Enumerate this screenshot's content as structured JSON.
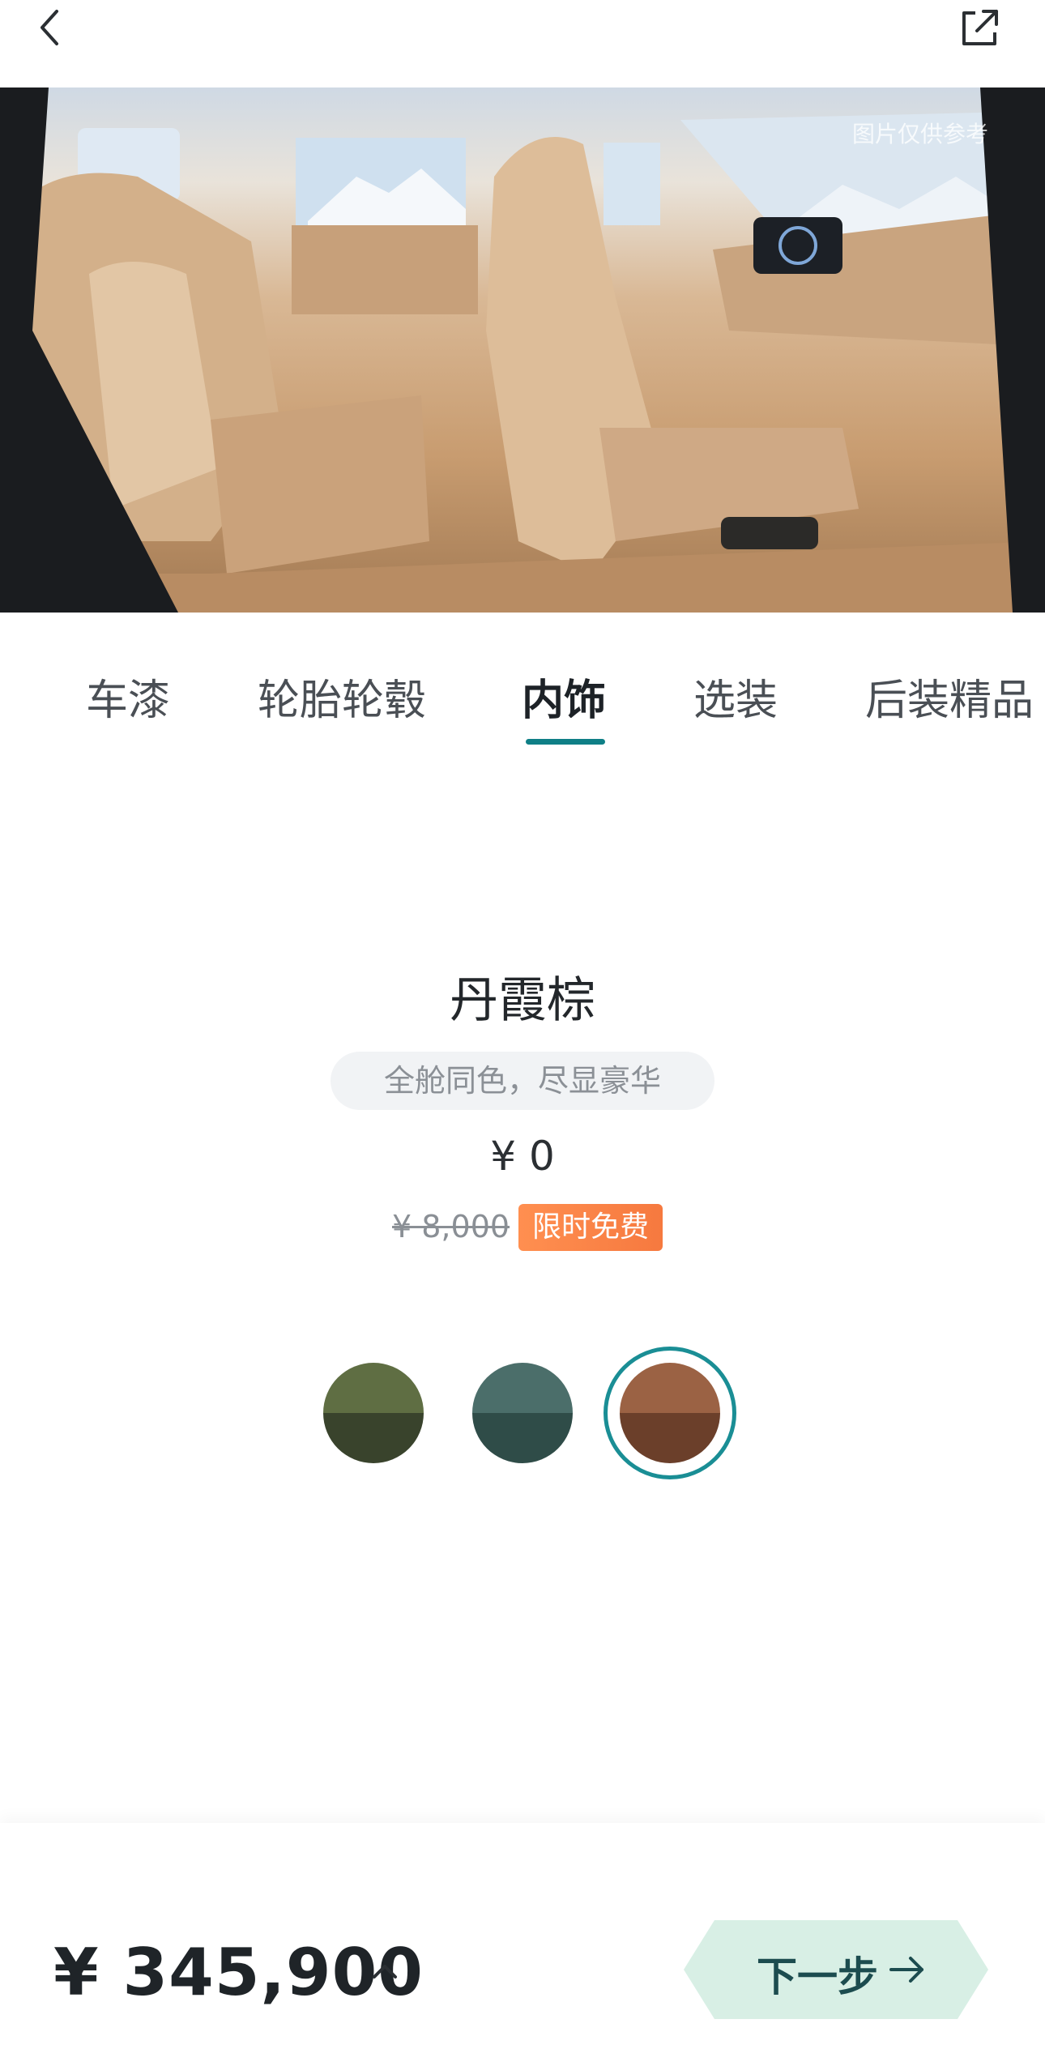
{
  "hero": {
    "note": "图片仅供参考"
  },
  "tabs": [
    {
      "label": "车漆",
      "active": false
    },
    {
      "label": "轮胎轮毂",
      "active": false
    },
    {
      "label": "内饰",
      "active": true
    },
    {
      "label": "选装",
      "active": false
    },
    {
      "label": "后装精品",
      "active": false
    }
  ],
  "option": {
    "color_name": "丹霞棕",
    "slogan": "全舱同色，尽显豪华",
    "price": "¥ 0",
    "original_price": "¥ 8,000",
    "promo_badge": "限时免费"
  },
  "swatches": [
    {
      "name": "green",
      "top": "#5f6e43",
      "bottom": "#39432c",
      "selected": false
    },
    {
      "name": "teal",
      "top": "#4b6e6a",
      "bottom": "#2f4c48",
      "selected": false
    },
    {
      "name": "brown",
      "top": "#9b6244",
      "bottom": "#6b3f2a",
      "selected": true
    }
  ],
  "footer": {
    "total_price": "¥ 345,900",
    "next_label": "下一步"
  },
  "colors": {
    "accent": "#0f7f86",
    "promo": "#f6793f",
    "next_button_bg": "#d8efe5"
  }
}
